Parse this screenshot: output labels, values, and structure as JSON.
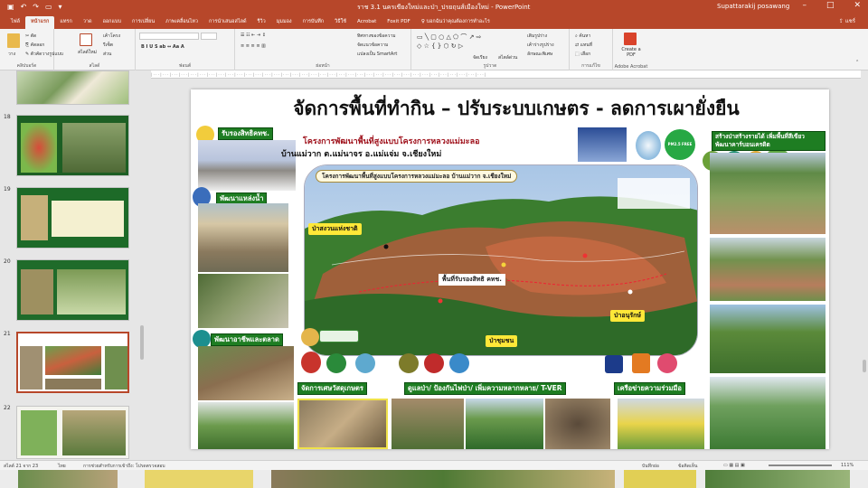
{
  "window": {
    "title": "ราช 3.1 นครเขียงใหม่และป่า_ปรยฤนส์เมืองใหม่ - PowerPoint",
    "user": "Supattarakij posawang"
  },
  "tabs": [
    "ไฟล์",
    "หน้าแรก",
    "แทรก",
    "วาด",
    "ออกแบบ",
    "การเปลี่ยน",
    "ภาพเคลื่อนไหว",
    "การนำเสนอสไลด์",
    "รีวิว",
    "มุมมอง",
    "การบันทึก",
    "วิธีใช้",
    "Acrobat",
    "Foxit PDF"
  ],
  "active_tab": "หน้าแรก",
  "tell_me": "บอกฉันว่าคุณต้องการทำอะไร",
  "share": "แชร์",
  "ribbon": {
    "clipboard": {
      "label": "คลิปบอร์ด",
      "paste": "วาง",
      "cut": "ตัด",
      "copy": "คัดลอก",
      "format": "ตัวคัดวางรูปแบบ"
    },
    "slides": {
      "label": "สไลด์",
      "new": "สไลด์ใหม่",
      "layout": "เค้าโครง",
      "reset": "รีเซ็ต",
      "section": "ส่วน"
    },
    "font": {
      "label": "ฟอนต์"
    },
    "paragraph": {
      "label": "ย่อหน้า",
      "direction": "ทิศทางของข้อความ",
      "align": "จัดแนวข้อความ",
      "smartart": "แปลงเป็น SmartArt"
    },
    "drawing": {
      "label": "รูปวาด",
      "arrange": "จัดเรียง",
      "quick_styles": "สไตล์ด่วน",
      "fill": "เติมรูปร่าง",
      "outline": "เค้าร่างรูปร่าง",
      "effects": "ลักษณะพิเศษ"
    },
    "editing": {
      "label": "การแก้ไข",
      "find": "ค้นหา",
      "replace": "แทนที่",
      "select": "เลือก"
    },
    "acrobat": {
      "label": "Adobe Acrobat",
      "create": "Create a PDF"
    }
  },
  "thumbnails": [
    {
      "num": "",
      "selected": false
    },
    {
      "num": "18",
      "selected": false
    },
    {
      "num": "19",
      "selected": false
    },
    {
      "num": "20",
      "selected": false
    },
    {
      "num": "21",
      "selected": true
    },
    {
      "num": "22",
      "selected": false
    }
  ],
  "slide": {
    "title": "จัดการพื้นที่ทำกิน – ปรับระบบเกษตร - ลดการเผายั่งยืน",
    "cert_label": "รับรองสิทธิคทช.",
    "water_label": "พัฒนาแหล่งน้ำ",
    "market_label": "พัฒนาอาชีพและตลาด",
    "project_line1": "โครงการพัฒนาพื้นที่สูงแบบโครงการหลวงแม่มะลอ",
    "project_line2": "บ้านแม่วาก ต.แม่นาจร อ.แม่แจ่ม จ.เชียงใหม่",
    "map_header": "โครงการพัฒนาพื้นที่สูงแบบโครงการหลวงแม่มะลอ บ้านแม่วาก จ.เชียงใหม่",
    "map_labels": {
      "national_forest": "ป่าสงวนแห่งชาติ",
      "certified_area": "พื้นที่รับรองสิทธิ คทช.",
      "protected_forest": "ป่าอนุรักษ์",
      "community_forest": "ป่าชุมชน"
    },
    "badge": "PM2.5 FREE REWARD",
    "reforest_label": "สร้างป่าสร้างรายได้ เพิ่มพื้นที่สีเขียว พัฒนาคาร์บอนเครดิต",
    "bottom": {
      "agri": "จัดการเศษวัสดุเกษตร",
      "forest": "ดูแลป่า/ ป้องกันไฟป่า/ เพิ่มความหลากหลาย/ T-VER",
      "network": "เครือข่ายความร่วมมือ"
    }
  },
  "status": {
    "slide_info": "สไลด์ 21 จาก 23",
    "language": "ไทย",
    "accessibility": "การช่วยสำหรับการเข้าถึง: โปรดตรวจสอบ",
    "notes": "บันทึกย่อ",
    "comments": "ข้อคิดเห็น",
    "zoom": "111%"
  },
  "colors": {
    "accent": "#b7472a",
    "green_label": "#1e7d22",
    "yellow_label": "#ffe838"
  }
}
